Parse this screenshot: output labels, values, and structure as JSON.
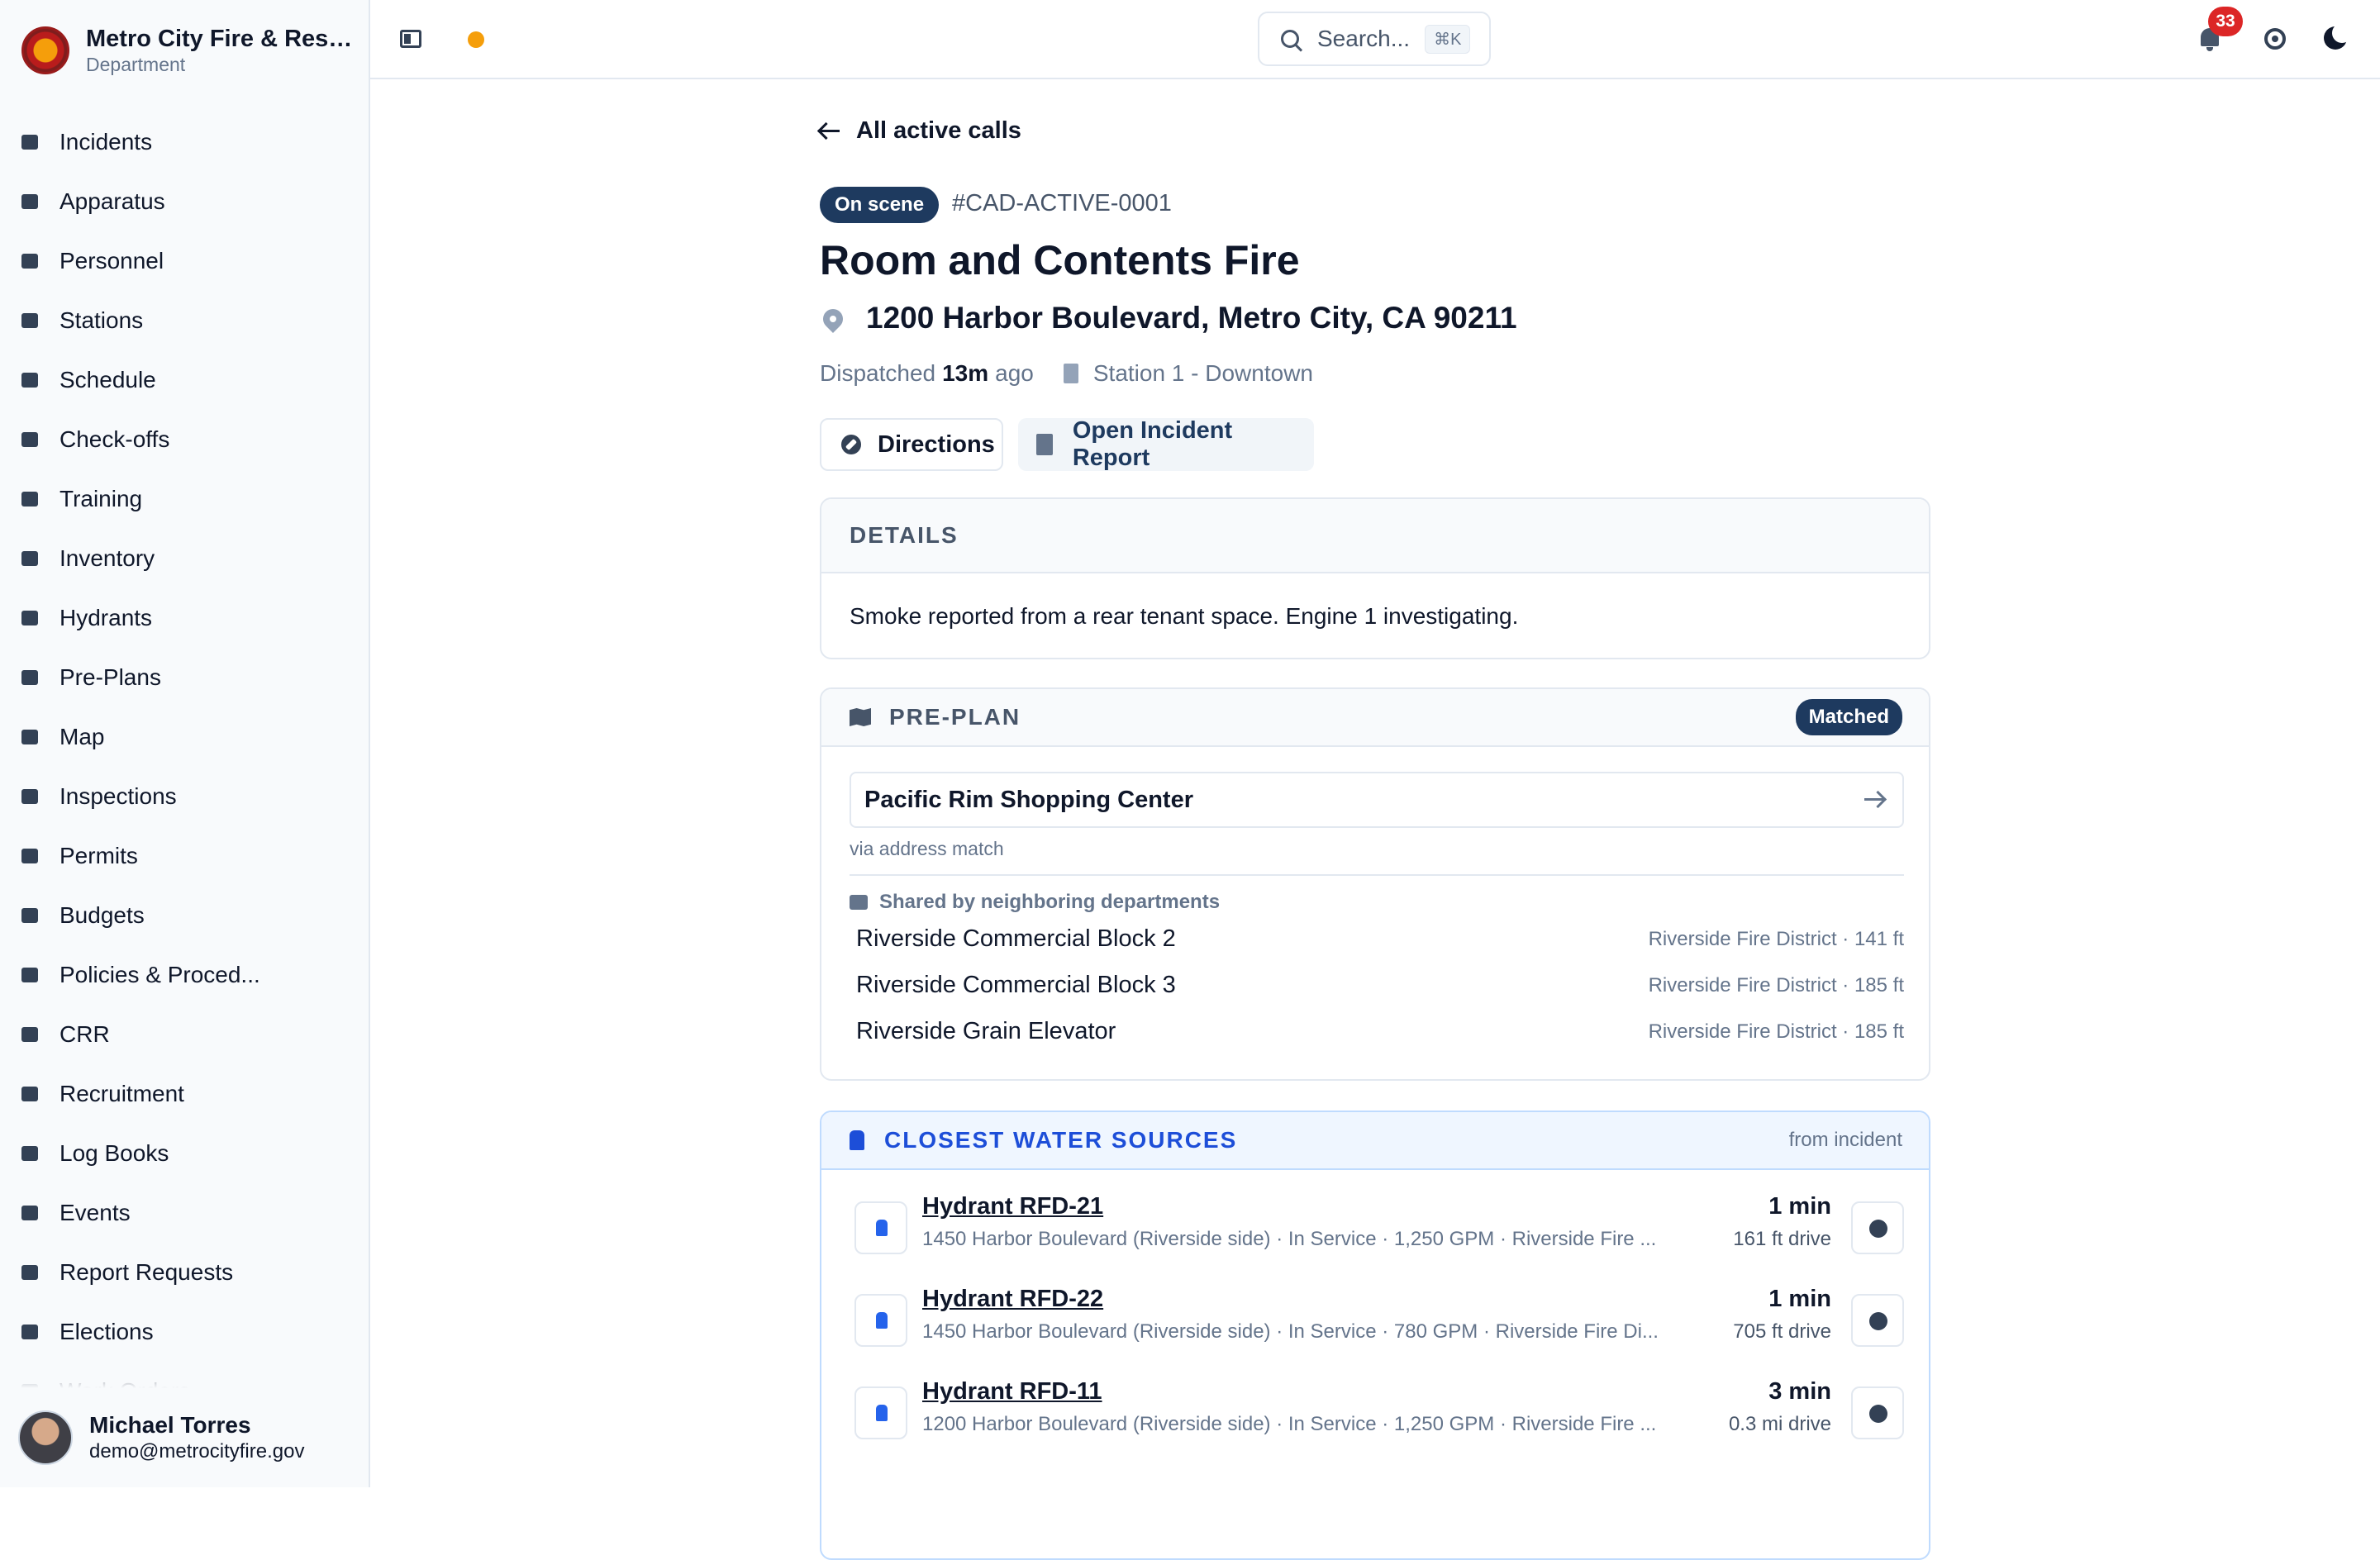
{
  "org": {
    "name": "Metro City Fire & Resc...",
    "sub": "Department"
  },
  "nav": [
    {
      "label": "Incidents",
      "icon": "incidents-icon"
    },
    {
      "label": "Apparatus",
      "icon": "truck-icon"
    },
    {
      "label": "Personnel",
      "icon": "id-card-icon"
    },
    {
      "label": "Stations",
      "icon": "building-icon"
    },
    {
      "label": "Schedule",
      "icon": "calendar-icon"
    },
    {
      "label": "Check-offs",
      "icon": "clipboard-icon"
    },
    {
      "label": "Training",
      "icon": "graduation-cap-icon"
    },
    {
      "label": "Inventory",
      "icon": "wrench-icon"
    },
    {
      "label": "Hydrants",
      "icon": "hydrant-icon"
    },
    {
      "label": "Pre-Plans",
      "icon": "preplan-icon"
    },
    {
      "label": "Map",
      "icon": "map-icon"
    },
    {
      "label": "Inspections",
      "icon": "inspection-icon"
    },
    {
      "label": "Permits",
      "icon": "permit-icon"
    },
    {
      "label": "Budgets",
      "icon": "piggy-bank-icon"
    },
    {
      "label": "Policies & Proced...",
      "icon": "book-icon"
    },
    {
      "label": "CRR",
      "icon": "megaphone-icon"
    },
    {
      "label": "Recruitment",
      "icon": "handshake-icon"
    },
    {
      "label": "Log Books",
      "icon": "books-icon"
    },
    {
      "label": "Events",
      "icon": "calendar-star-icon"
    },
    {
      "label": "Report Requests",
      "icon": "report-icon"
    },
    {
      "label": "Elections",
      "icon": "ballot-icon"
    },
    {
      "label": "Work Orders",
      "icon": "work-order-icon"
    }
  ],
  "user": {
    "name": "Michael Torres",
    "email": "demo@metrocityfire.gov"
  },
  "topbar": {
    "search_placeholder": "Search...",
    "search_shortcut": "⌘K",
    "notification_count": "33"
  },
  "incident": {
    "back_label": "All active calls",
    "status": "On scene",
    "cad_id": "#CAD-ACTIVE-0001",
    "title": "Room and Contents Fire",
    "address": "1200 Harbor Boulevard, Metro City, CA 90211",
    "dispatched_prefix": "Dispatched",
    "dispatched_time": "13m",
    "dispatched_suffix": "ago",
    "station": "Station 1 - Downtown",
    "directions_label": "Directions",
    "report_label": "Open Incident Report"
  },
  "details": {
    "heading": "DETAILS",
    "text": "Smoke reported from a rear tenant space. Engine 1 investigating."
  },
  "preplan": {
    "heading": "PRE-PLAN",
    "badge": "Matched",
    "match_name": "Pacific Rim Shopping Center",
    "match_via": "via address match",
    "shared_label": "Shared by neighboring departments",
    "neighbors": [
      {
        "name": "Riverside Commercial Block 2",
        "meta": "Riverside Fire District · 141 ft"
      },
      {
        "name": "Riverside Commercial Block 3",
        "meta": "Riverside Fire District · 185 ft"
      },
      {
        "name": "Riverside Grain Elevator",
        "meta": "Riverside Fire District · 185 ft"
      }
    ]
  },
  "water": {
    "heading": "CLOSEST WATER SOURCES",
    "from_label": "from incident",
    "hydrants": [
      {
        "name": "Hydrant RFD-21",
        "desc": "1450 Harbor Boulevard (Riverside side) · In Service · 1,250 GPM · Riverside Fire ...",
        "time": "1 min",
        "distance": "161 ft drive"
      },
      {
        "name": "Hydrant RFD-22",
        "desc": "1450 Harbor Boulevard (Riverside side) · In Service · 780 GPM · Riverside Fire Di...",
        "time": "1 min",
        "distance": "705 ft drive"
      },
      {
        "name": "Hydrant RFD-11",
        "desc": "1200 Harbor Boulevard (Riverside side) · In Service · 1,250 GPM · Riverside Fire ...",
        "time": "3 min",
        "distance": "0.3 mi drive"
      }
    ]
  }
}
